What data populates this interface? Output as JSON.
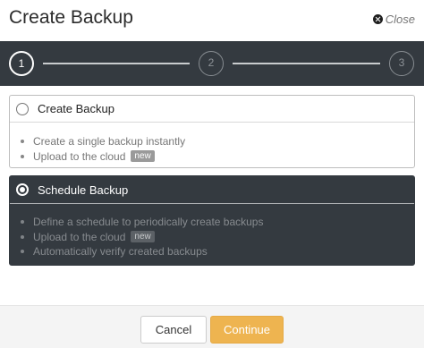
{
  "dialog": {
    "title": "Create Backup",
    "close_label": "Close"
  },
  "stepper": {
    "steps": [
      "1",
      "2",
      "3"
    ],
    "active_step": "1"
  },
  "options": [
    {
      "label": "Create Backup",
      "selected": false,
      "bullets": [
        {
          "text": "Create a single backup instantly",
          "badge": ""
        },
        {
          "text": "Upload to the cloud",
          "badge": "new"
        }
      ]
    },
    {
      "label": "Schedule Backup",
      "selected": true,
      "bullets": [
        {
          "text": "Define a schedule to periodically create backups",
          "badge": ""
        },
        {
          "text": "Upload to the cloud",
          "badge": "new"
        },
        {
          "text": "Automatically verify created backups",
          "badge": ""
        }
      ]
    }
  ],
  "footer": {
    "cancel_label": "Cancel",
    "continue_label": "Continue"
  },
  "colors": {
    "dark_panel": "#343a40",
    "accent": "#eeb450"
  },
  "icons": {
    "close": "close-circle-icon",
    "radio_on": "radio-selected-icon",
    "radio_off": "radio-unselected-icon"
  }
}
